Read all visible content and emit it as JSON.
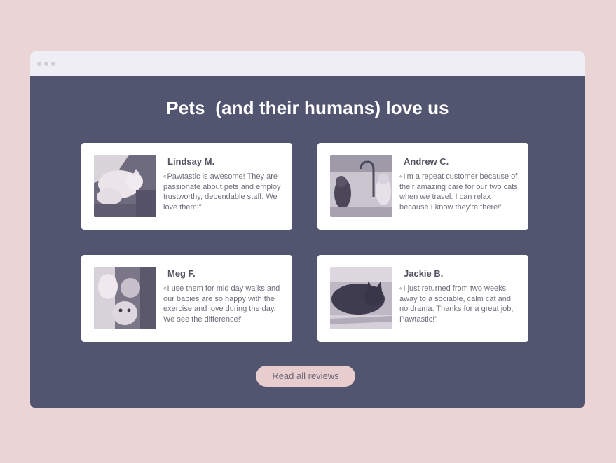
{
  "section": {
    "heading": "Pets  (and their humans) love us"
  },
  "reviews": [
    {
      "name": "Lindsay M.",
      "quote_open": "«",
      "text": "Pawtastic is awesome! They are passionate about pets and employ trustworthy, dependable staff. We love them!\"",
      "photo_icon": "cat-lying-on-rug"
    },
    {
      "name": "Andrew C.",
      "quote_open": "«",
      "text": "I'm a repeat customer because of their amazing care for our two cats when we travel. I can relax because I know they're there!\"",
      "photo_icon": "two-cats-at-sink"
    },
    {
      "name": "Meg F.",
      "quote_open": "«",
      "text": "I use them for mid day walks and our babies are so happy with the exercise and love during the day. We see the difference!\"",
      "photo_icon": "two-dogs-with-owner"
    },
    {
      "name": "Jackie B.",
      "quote_open": "«",
      "text": "I just returned from two weeks away to a sociable, calm cat and no drama. Thanks for a great job, Pawtastic!\"",
      "photo_icon": "black-cat-on-bed"
    }
  ],
  "cta": {
    "label": "Read all reviews"
  },
  "colors": {
    "page_background": "#ebd4d5",
    "section_background": "#525570",
    "card_background": "#ffffff",
    "button_background": "#e7cdcd"
  }
}
